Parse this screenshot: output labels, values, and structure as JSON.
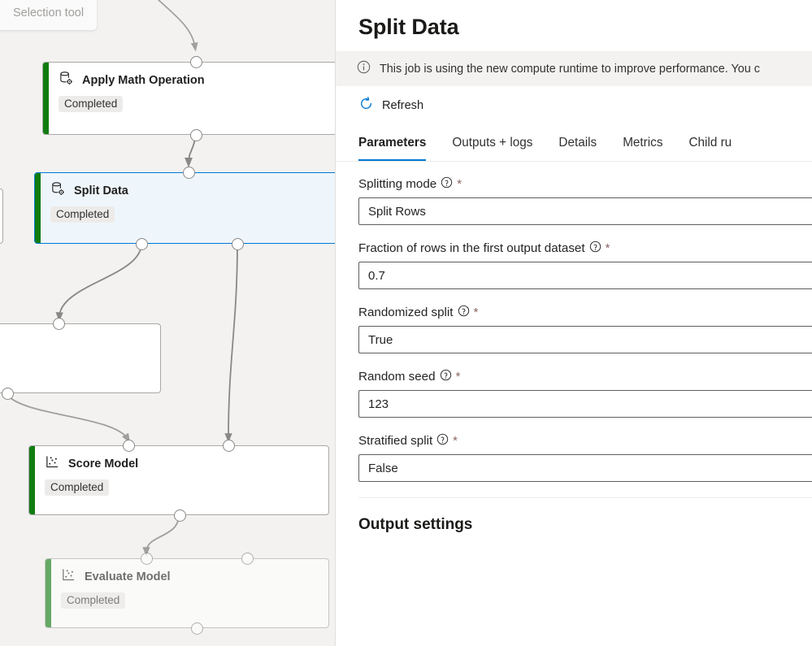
{
  "canvas": {
    "tooltip": {
      "label": "Selection tool"
    },
    "nodes": [
      {
        "title": "Apply Math Operation",
        "status": "Completed",
        "icon": "database-gear-icon"
      },
      {
        "title": "Split Data",
        "status": "Completed",
        "icon": "database-gear-icon"
      },
      {
        "title": "",
        "status": "",
        "icon": ""
      },
      {
        "title": "Score Model",
        "status": "Completed",
        "icon": "scatter-plot-icon"
      },
      {
        "title": "Evaluate Model",
        "status": "Completed",
        "icon": "scatter-plot-icon"
      }
    ]
  },
  "panel": {
    "title": "Split Data",
    "info_banner": {
      "icon": "info-circle-icon",
      "text": "This job is using the new compute runtime to improve performance. You c"
    },
    "command_bar": {
      "refresh_label": "Refresh",
      "refresh_icon": "refresh-icon"
    },
    "tabs": [
      {
        "label": "Parameters",
        "active": true
      },
      {
        "label": "Outputs + logs",
        "active": false
      },
      {
        "label": "Details",
        "active": false
      },
      {
        "label": "Metrics",
        "active": false
      },
      {
        "label": "Child ru",
        "active": false
      }
    ],
    "parameters": [
      {
        "label": "Splitting mode",
        "required": "*",
        "value": "Split Rows"
      },
      {
        "label": "Fraction of rows in the first output dataset",
        "required": "*",
        "value": "0.7"
      },
      {
        "label": "Randomized split",
        "required": "*",
        "value": "True"
      },
      {
        "label": "Random seed",
        "required": "*",
        "value": "123"
      },
      {
        "label": "Stratified split",
        "required": "*",
        "value": "False"
      }
    ],
    "output_settings_title": "Output settings"
  },
  "colors": {
    "accent": "#0078d4",
    "status_completed": "#107c10",
    "canvas_bg": "#f3f2f1",
    "selected_node_bg": "#eff6fb"
  }
}
